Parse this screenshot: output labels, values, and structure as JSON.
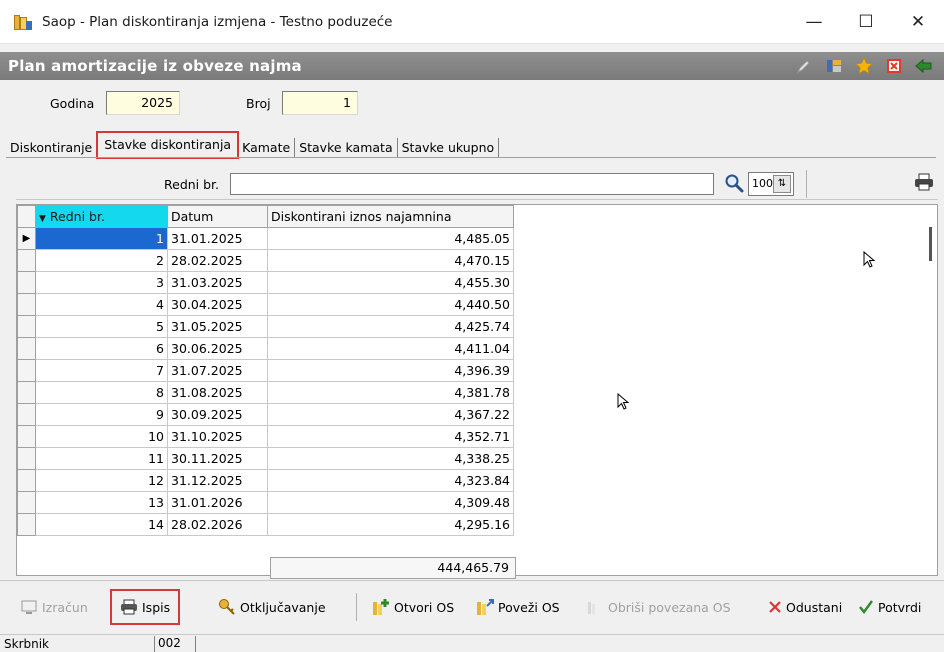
{
  "window": {
    "title": "Saop  - Plan diskontiranja izmjena  - Testno poduzeće",
    "minimize": "—",
    "maximize": "☐",
    "close": "✕"
  },
  "banner": {
    "title": "Plan amortizacije iz obveze najma",
    "icons": [
      "edit-icon",
      "layout-icon",
      "star-icon",
      "close-form-icon",
      "exit-icon"
    ]
  },
  "header": {
    "godina_label": "Godina",
    "godina_value": "2025",
    "broj_label": "Broj",
    "broj_value": "1"
  },
  "tabs": [
    {
      "label": "Diskontiranje",
      "active": false
    },
    {
      "label": "Stavke diskontiranja",
      "active": true
    },
    {
      "label": "Kamate",
      "active": false
    },
    {
      "label": "Stavke kamata",
      "active": false
    },
    {
      "label": "Stavke ukupno",
      "active": false
    }
  ],
  "search": {
    "label": "Redni br.",
    "value": "",
    "limit": "100"
  },
  "grid": {
    "columns": [
      "Redni br.",
      "Datum",
      "Diskontirani iznos najamnina"
    ],
    "rows": [
      [
        "1",
        "31.01.2025",
        "4,485.05"
      ],
      [
        "2",
        "28.02.2025",
        "4,470.15"
      ],
      [
        "3",
        "31.03.2025",
        "4,455.30"
      ],
      [
        "4",
        "30.04.2025",
        "4,440.50"
      ],
      [
        "5",
        "31.05.2025",
        "4,425.74"
      ],
      [
        "6",
        "30.06.2025",
        "4,411.04"
      ],
      [
        "7",
        "31.07.2025",
        "4,396.39"
      ],
      [
        "8",
        "31.08.2025",
        "4,381.78"
      ],
      [
        "9",
        "30.09.2025",
        "4,367.22"
      ],
      [
        "10",
        "31.10.2025",
        "4,352.71"
      ],
      [
        "11",
        "30.11.2025",
        "4,338.25"
      ],
      [
        "12",
        "31.12.2025",
        "4,323.84"
      ],
      [
        "13",
        "31.01.2026",
        "4,309.48"
      ],
      [
        "14",
        "28.02.2026",
        "4,295.16"
      ]
    ],
    "total": "444,465.79"
  },
  "toolbar": {
    "izracun": "Izračun",
    "ispis": "Ispis",
    "otkljucavanje": "Otključavanje",
    "otvori_os": "Otvori OS",
    "povezi_os": "Poveži OS",
    "obrisi_povezana_os": "Obriši povezana OS",
    "odustani": "Odustani",
    "potvrdi": "Potvrdi"
  },
  "status": {
    "label": "Skrbnik",
    "value": "002"
  },
  "colors": {
    "sorted_header": "#14d9ee",
    "selection": "#1c68d1",
    "input_bg": "#fffde0",
    "highlight": "#d6373a"
  }
}
